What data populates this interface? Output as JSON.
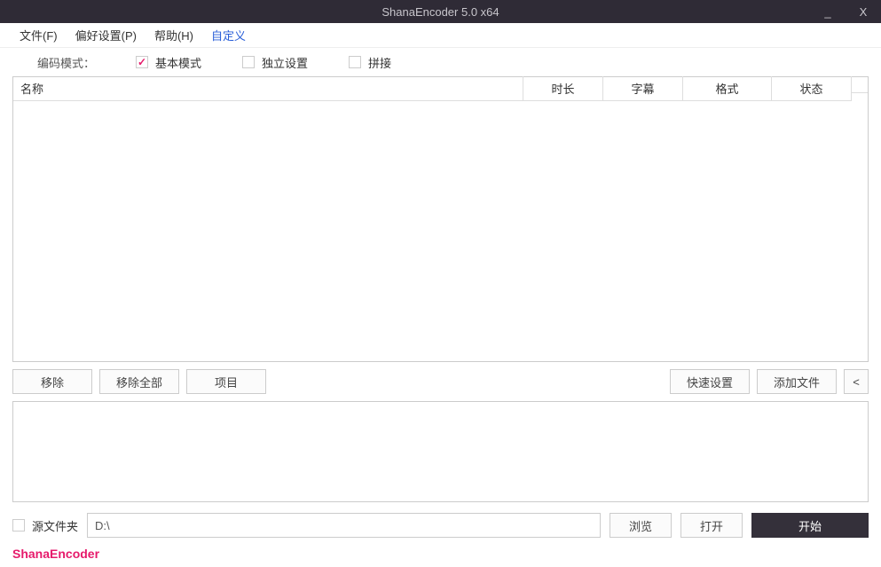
{
  "titlebar": {
    "title": "ShanaEncoder 5.0 x64",
    "minimize": "_",
    "close": "X"
  },
  "menubar": {
    "file": "文件(F)",
    "prefs": "偏好设置(P)",
    "help": "帮助(H)",
    "custom": "自定义"
  },
  "mode": {
    "label": "编码模式：",
    "basic": "基本模式",
    "independent": "独立设置",
    "concat": "拼接"
  },
  "table": {
    "headers": {
      "name": "名称",
      "duration": "时长",
      "subtitle": "字幕",
      "format": "格式",
      "status": "状态"
    }
  },
  "buttons": {
    "remove": "移除",
    "remove_all": "移除全部",
    "project": "项目",
    "quick_set": "快速设置",
    "add_file": "添加文件",
    "collapse": "<",
    "browse": "浏览",
    "open": "打开",
    "start": "开始"
  },
  "bottom": {
    "source_folder": "源文件夹",
    "path": "D:\\"
  },
  "footer": {
    "brand": "ShanaEncoder"
  }
}
